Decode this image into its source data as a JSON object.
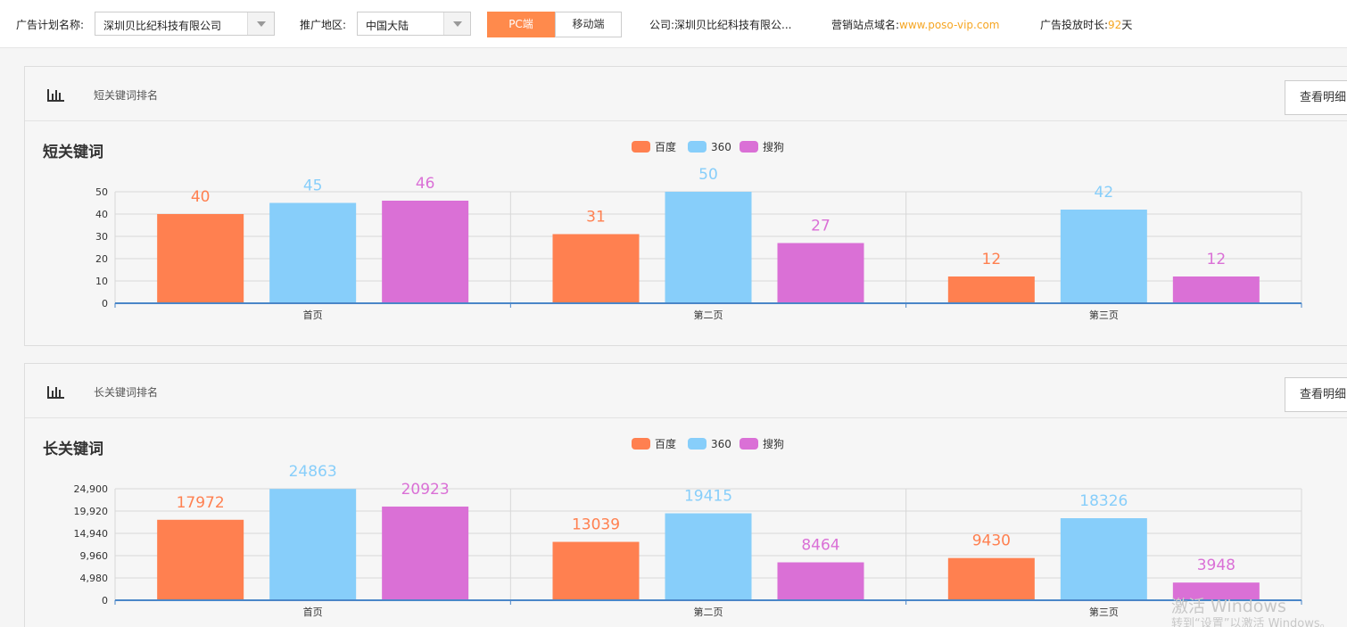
{
  "toolbar": {
    "plan_label": "广告计划名称:",
    "plan_value": "深圳贝比纪科技有限公司",
    "region_label": "推广地区:",
    "region_value": "中国大陆",
    "pc_label": "PC端",
    "mobile_label": "移动端",
    "company_label": "公司:",
    "company_value": "深圳贝比纪科技有限公...",
    "domain_label": "营销站点域名:",
    "domain_value": "www.poso-vip.com",
    "duration_label": "广告投放时长:",
    "duration_value": "92",
    "duration_unit": "天"
  },
  "panels": [
    {
      "header": "短关键词排名",
      "detail_label": "查看明细"
    },
    {
      "header": "长关键词排名",
      "detail_label": "查看明细"
    }
  ],
  "colors": {
    "baidu": "#ff8050",
    "s360": "#87cefa",
    "sogou": "#da70d6",
    "axis": "#4a86c8",
    "accent": "#ff8a4c",
    "highlight": "#f6a623"
  },
  "chart_data": [
    {
      "type": "bar",
      "title": "短关键词",
      "categories": [
        "首页",
        "第二页",
        "第三页"
      ],
      "series": [
        {
          "name": "百度",
          "values": [
            40,
            31,
            12
          ]
        },
        {
          "name": "360",
          "values": [
            45,
            50,
            42
          ]
        },
        {
          "name": "搜狗",
          "values": [
            46,
            27,
            12
          ]
        }
      ],
      "ylim": [
        0,
        50
      ],
      "yticks": [
        "0",
        "10",
        "20",
        "30",
        "40",
        "50"
      ],
      "legend": "top-center",
      "grid": true
    },
    {
      "type": "bar",
      "title": "长关键词",
      "categories": [
        "首页",
        "第二页",
        "第三页"
      ],
      "series": [
        {
          "name": "百度",
          "values": [
            17972,
            13039,
            9430
          ]
        },
        {
          "name": "360",
          "values": [
            24863,
            19415,
            18326
          ]
        },
        {
          "name": "搜狗",
          "values": [
            20923,
            8464,
            3948
          ]
        }
      ],
      "ylim": [
        0,
        24900
      ],
      "yticks": [
        "0",
        "4,980",
        "9,960",
        "14,940",
        "19,920",
        "24,900"
      ],
      "legend": "top-center",
      "grid": true
    }
  ],
  "watermark": {
    "line1": "激活 Windows",
    "line2": "转到“设置”以激活 Windows。"
  }
}
